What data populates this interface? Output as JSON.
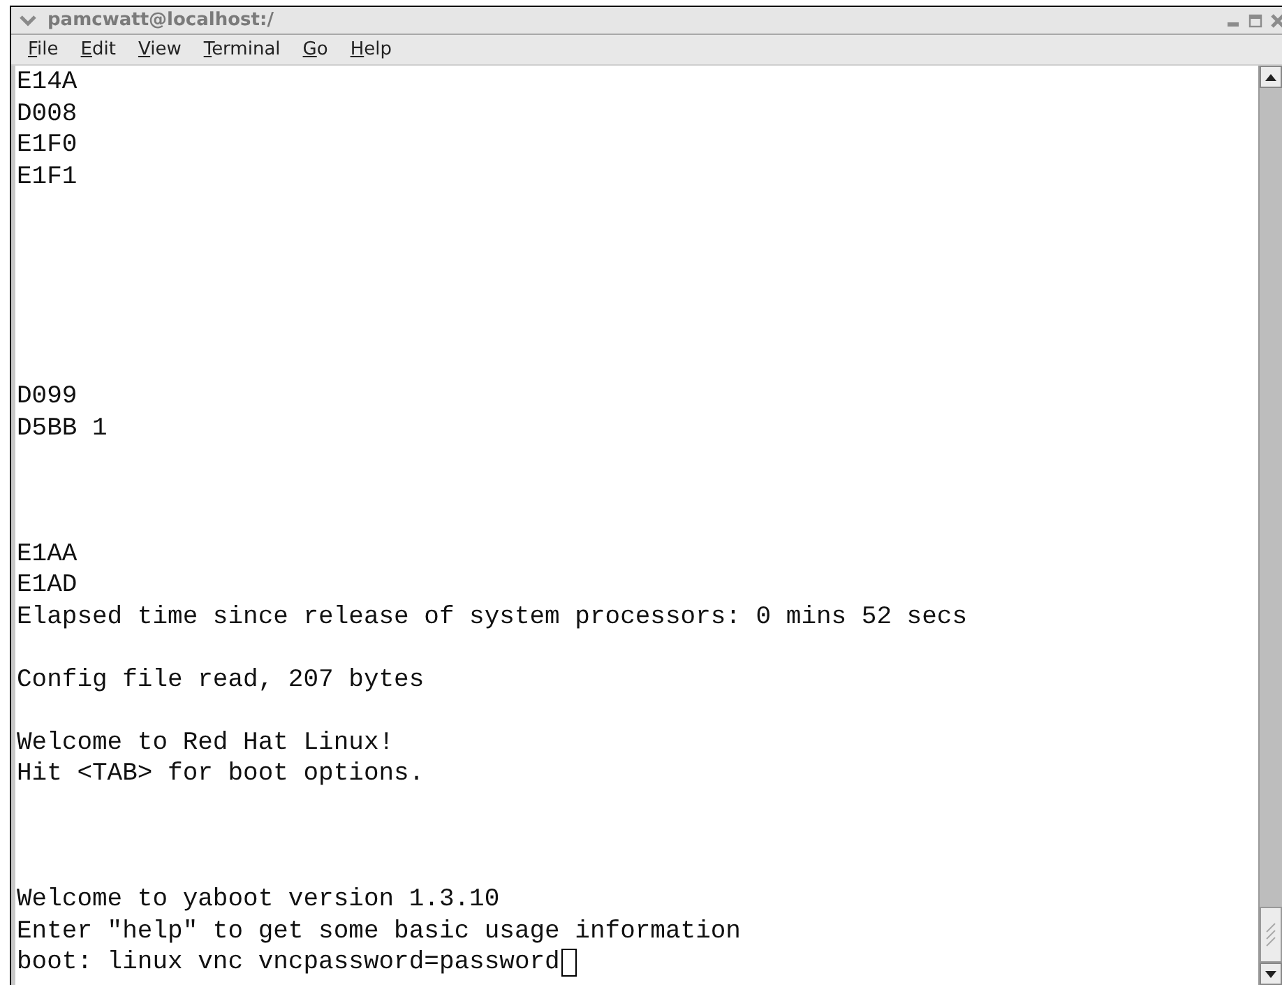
{
  "window": {
    "title": "pamcwatt@localhost:/"
  },
  "menu": [
    {
      "label": "File"
    },
    {
      "label": "Edit"
    },
    {
      "label": "View"
    },
    {
      "label": "Terminal"
    },
    {
      "label": "Go"
    },
    {
      "label": "Help"
    }
  ],
  "terminal": {
    "lines": [
      "E14A",
      "D008",
      "E1F0",
      "E1F1",
      "D099",
      "D5BB 1",
      "E1AA",
      "E1AD",
      "Elapsed time since release of system processors: 0 mins 52 secs",
      "Config file read, 207 bytes",
      "Welcome to Red Hat Linux!",
      "Hit <TAB> for boot options.",
      "Welcome to yaboot version 1.3.10",
      "Enter \"help\" to get some basic usage information",
      "boot: linux vnc vncpassword=password"
    ]
  }
}
